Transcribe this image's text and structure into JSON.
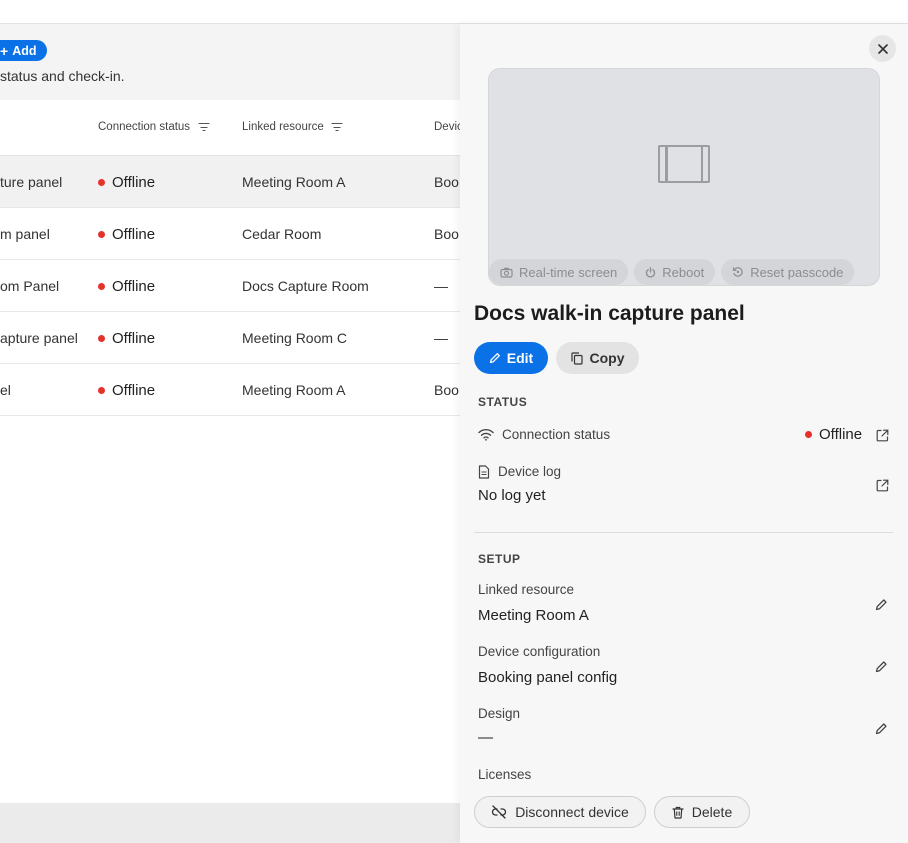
{
  "page": {
    "add_label": "Add",
    "subtitle": "status and check-in."
  },
  "table": {
    "columns": [
      {
        "label": "Connection status"
      },
      {
        "label": "Linked resource"
      },
      {
        "label": "Devic"
      }
    ],
    "rows": [
      {
        "name": "ture panel",
        "status": "Offline",
        "resource": "Meeting Room A",
        "device": "Boo"
      },
      {
        "name": "m panel",
        "status": "Offline",
        "resource": "Cedar Room",
        "device": "Boo"
      },
      {
        "name": "om Panel",
        "status": "Offline",
        "resource": "Docs Capture Room",
        "device": "—"
      },
      {
        "name": "apture panel",
        "status": "Offline",
        "resource": "Meeting Room C",
        "device": "—"
      },
      {
        "name": "el",
        "status": "Offline",
        "resource": "Meeting Room A",
        "device": "Boo"
      }
    ]
  },
  "panel": {
    "title": "Docs walk-in capture panel",
    "preview_actions": {
      "realtime": "Real-time screen",
      "reboot": "Reboot",
      "reset": "Reset passcode"
    },
    "edit_label": "Edit",
    "copy_label": "Copy",
    "status_section": "STATUS",
    "connection_label": "Connection status",
    "connection_value": "Offline",
    "device_log_label": "Device log",
    "device_log_value": "No log yet",
    "setup_section": "SETUP",
    "linked_resource_label": "Linked resource",
    "linked_resource_value": "Meeting Room A",
    "device_config_label": "Device configuration",
    "device_config_value": "Booking panel config",
    "design_label": "Design",
    "design_value": "—",
    "licenses_label": "Licenses",
    "disconnect_label": "Disconnect device",
    "delete_label": "Delete"
  },
  "colors": {
    "accent": "#0a72e6",
    "offline": "#e5322d"
  }
}
